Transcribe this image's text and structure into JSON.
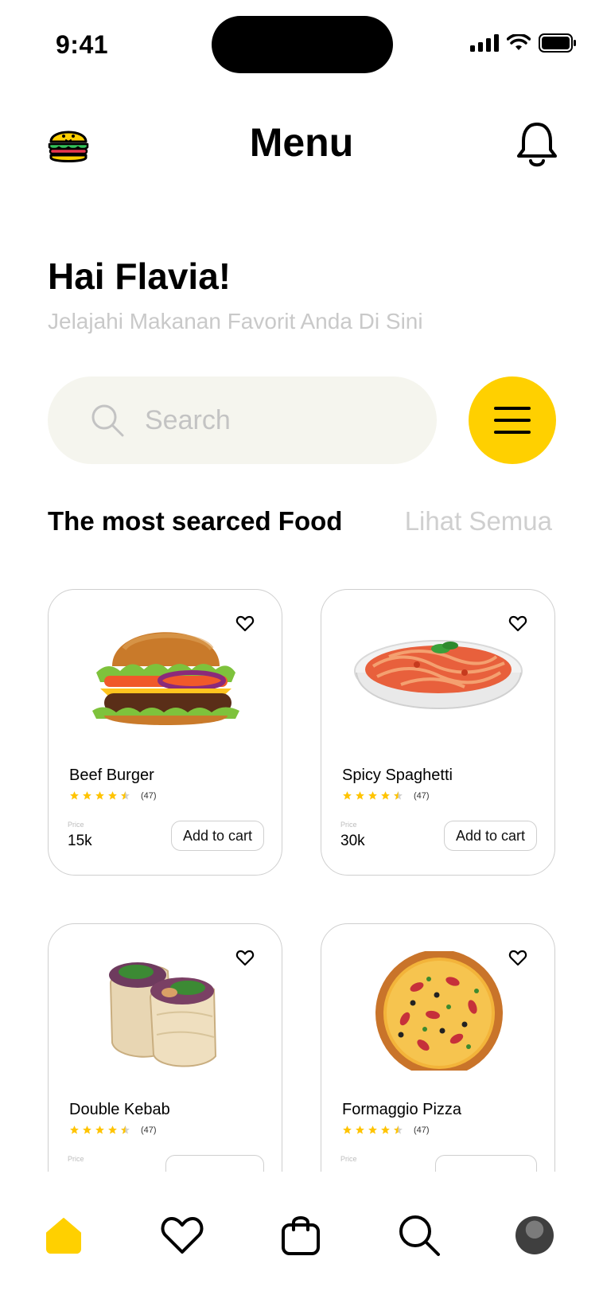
{
  "status_bar": {
    "time": "9:41"
  },
  "header": {
    "title": "Menu"
  },
  "greeting": {
    "title": "Hai Flavia!",
    "subtitle": "Jelajahi Makanan Favorit Anda Di Sini"
  },
  "search": {
    "placeholder": "Search"
  },
  "section": {
    "title": "The most searced Food",
    "see_all": "Lihat Semua"
  },
  "colors": {
    "accent": "#FFD000",
    "search_bg": "#F5F5EE",
    "muted": "#C9C9C9"
  },
  "foods": [
    {
      "name": "Beef Burger",
      "rating": 4.5,
      "reviews": "(47)",
      "price_label": "Price",
      "price": "15k",
      "cart_label": "Add to cart",
      "image": "burger-image"
    },
    {
      "name": "Spicy Spaghetti",
      "rating": 4.5,
      "reviews": "(47)",
      "price_label": "Price",
      "price": "30k",
      "cart_label": "Add to cart",
      "image": "spaghetti-image"
    },
    {
      "name": "Double Kebab",
      "rating": 4.5,
      "reviews": "(47)",
      "price_label": "Price",
      "price": "",
      "cart_label": "",
      "image": "kebab-image"
    },
    {
      "name": "Formaggio Pizza",
      "rating": 4.5,
      "reviews": "(47)",
      "price_label": "Price",
      "price": "",
      "cart_label": "",
      "image": "pizza-image"
    }
  ],
  "bottom_nav": [
    {
      "icon": "home-icon",
      "active": true
    },
    {
      "icon": "heart-icon",
      "active": false
    },
    {
      "icon": "bag-icon",
      "active": false
    },
    {
      "icon": "search-icon",
      "active": false
    },
    {
      "icon": "avatar",
      "active": false
    }
  ]
}
